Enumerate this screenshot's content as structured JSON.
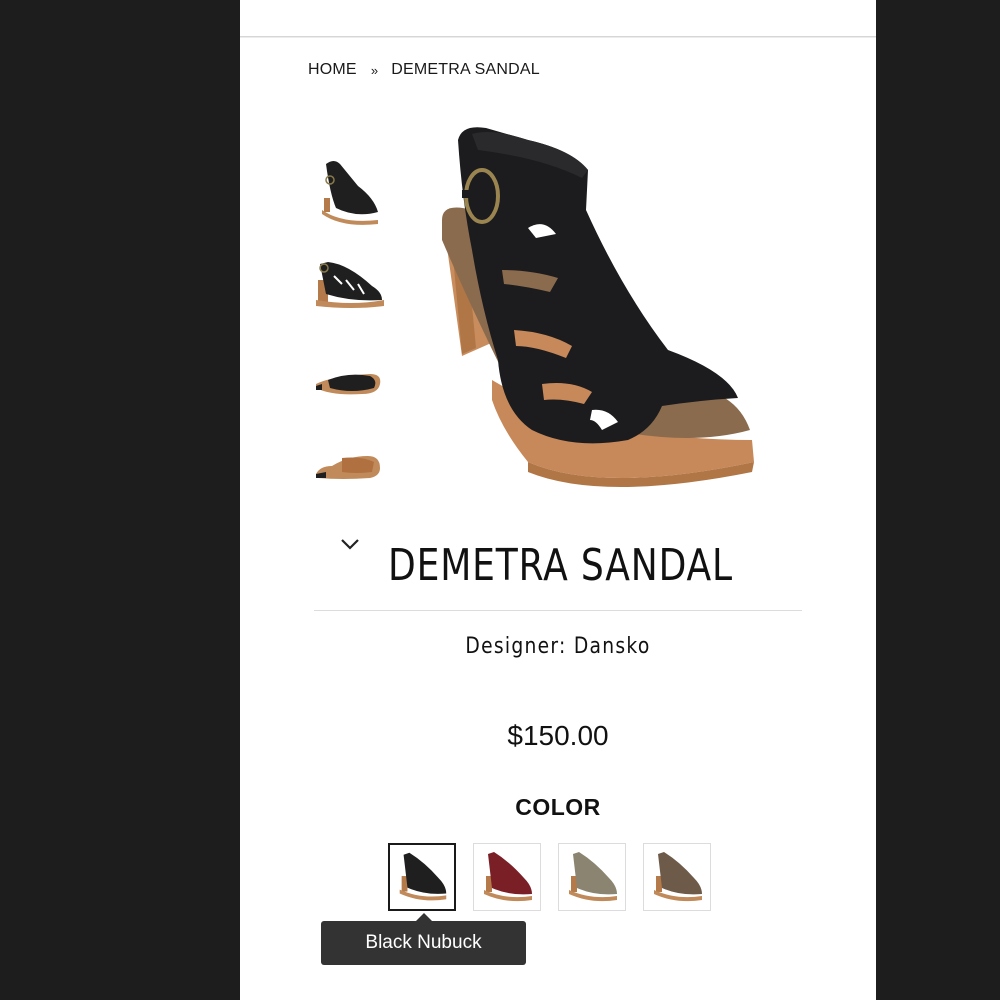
{
  "breadcrumb": {
    "home": "HOME",
    "separator": "»",
    "current": "DEMETRA SANDAL"
  },
  "product": {
    "title": "DEMETRA SANDAL",
    "designer": "Designer: Dansko",
    "price": "$150.00"
  },
  "thumbnails": [
    {
      "icon": "sandal-side-icon"
    },
    {
      "icon": "sandal-profile-icon"
    },
    {
      "icon": "sandal-top-icon"
    },
    {
      "icon": "sandal-sole-icon"
    }
  ],
  "color": {
    "label": "COLOR",
    "swatches": [
      {
        "name": "Black Nubuck",
        "hex": "#1f1f1f",
        "selected": true
      },
      {
        "name": "Red",
        "hex": "#7a1f26",
        "selected": false
      },
      {
        "name": "Taupe",
        "hex": "#8a8470",
        "selected": false
      },
      {
        "name": "Brown",
        "hex": "#6e5a48",
        "selected": false
      }
    ],
    "tooltip": "Black Nubuck"
  },
  "colors": {
    "background": "#1d1d1d",
    "page": "#ffffff",
    "tooltip_bg": "#333333"
  }
}
